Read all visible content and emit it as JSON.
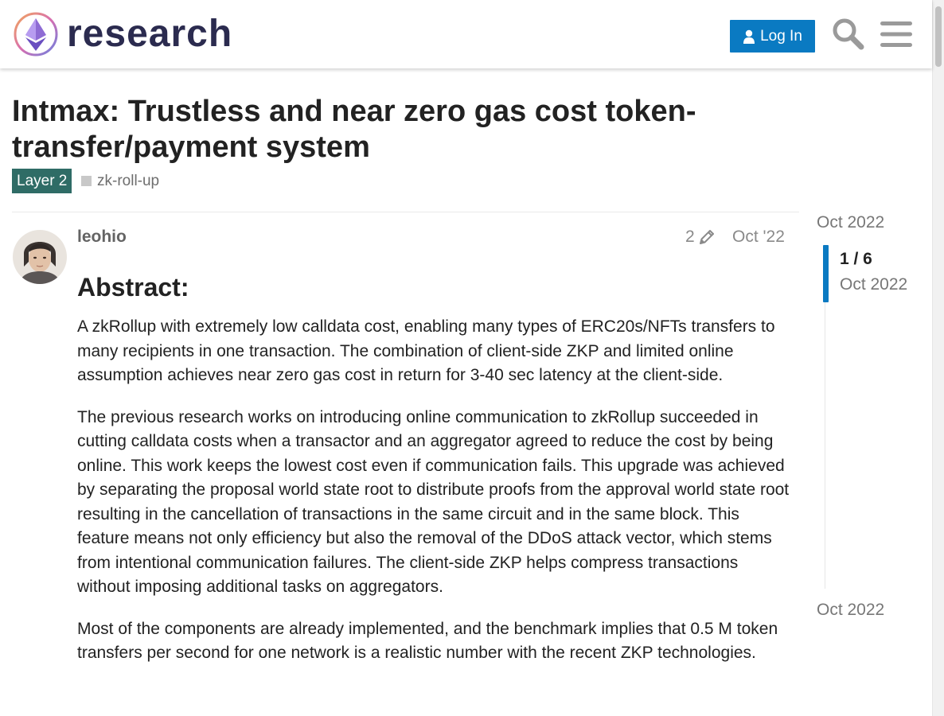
{
  "header": {
    "logo_text": "research",
    "login_label": "Log In",
    "search_icon": "search-icon",
    "menu_icon": "hamburger-menu-icon",
    "accent_color": "#0a7ac2"
  },
  "topic": {
    "title": "Intmax: Trustless and near zero gas cost token-transfer/payment system",
    "category": "Layer 2",
    "category_color": "#2f6c66",
    "tag": "zk-roll-up"
  },
  "post": {
    "username": "leohio",
    "edit_count": "2",
    "date": "Oct '22",
    "heading": "Abstract:",
    "paragraphs": [
      "A zkRollup with extremely low calldata cost, enabling many types of ERC20s/NFTs transfers to many recipients in one transaction. The combination of client-side ZKP and limited online assumption achieves near zero gas cost in return for 3-40 sec latency at the client-side.",
      "The previous research works on introducing online communication to zkRollup succeeded in cutting calldata costs when a transactor and an aggregator agreed to reduce the cost by being online. This work keeps the lowest cost even if communication fails. This upgrade was achieved by separating the proposal world state root to distribute proofs from the approval world state root resulting in the cancellation of transactions in the same circuit and in the same block. This feature means not only efficiency but also the removal of the DDoS attack vector, which stems from intentional communication failures. The client-side ZKP helps compress transactions without imposing additional tasks on aggregators.",
      "Most of the components are already implemented, and the benchmark implies that 0.5 M token transfers per second for one network is a realistic number with the recent ZKP technologies."
    ]
  },
  "timeline": {
    "start": "Oct 2022",
    "position": "1 / 6",
    "current_date": "Oct 2022",
    "end": "Oct 2022"
  }
}
